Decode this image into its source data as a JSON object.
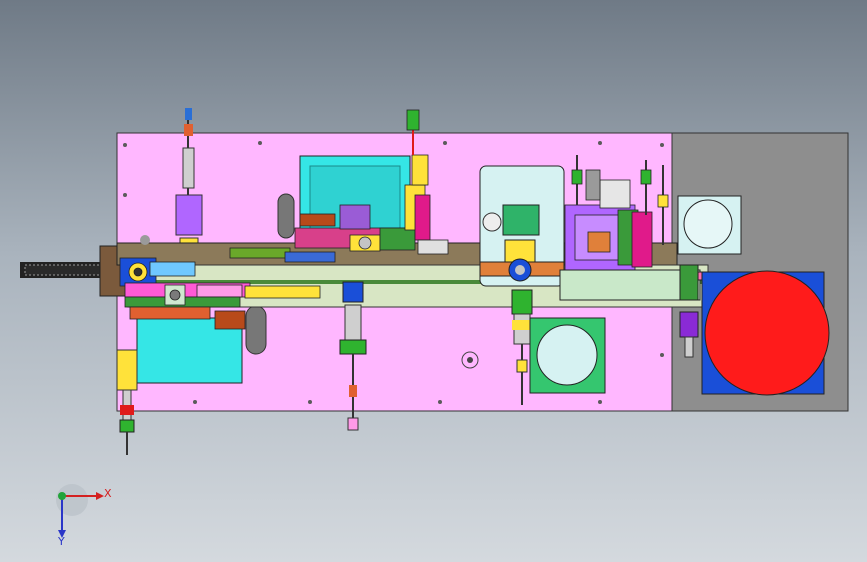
{
  "view": {
    "background_top": "#6f7a86",
    "background_bottom": "#d4d9de"
  },
  "colors": {
    "base_plate": "#ffb7ff",
    "frame": "#8e8e8e",
    "conveyor": "#d8e6c4",
    "cyan_plate": "#35e6e6",
    "turntable": "#ff1b1b",
    "turntable_base": "#1a4fd8",
    "light_plate": "#d6f2f2",
    "green_plate": "#35c66f",
    "purple_block": "#b066ff",
    "yellow_block": "#ffe23a",
    "orange_block": "#e0803a"
  },
  "triad": {
    "x_label": "X",
    "y_label": "Y",
    "x_color": "#d42020",
    "y_color": "#22a33a",
    "z_color": "#2a36c8"
  }
}
